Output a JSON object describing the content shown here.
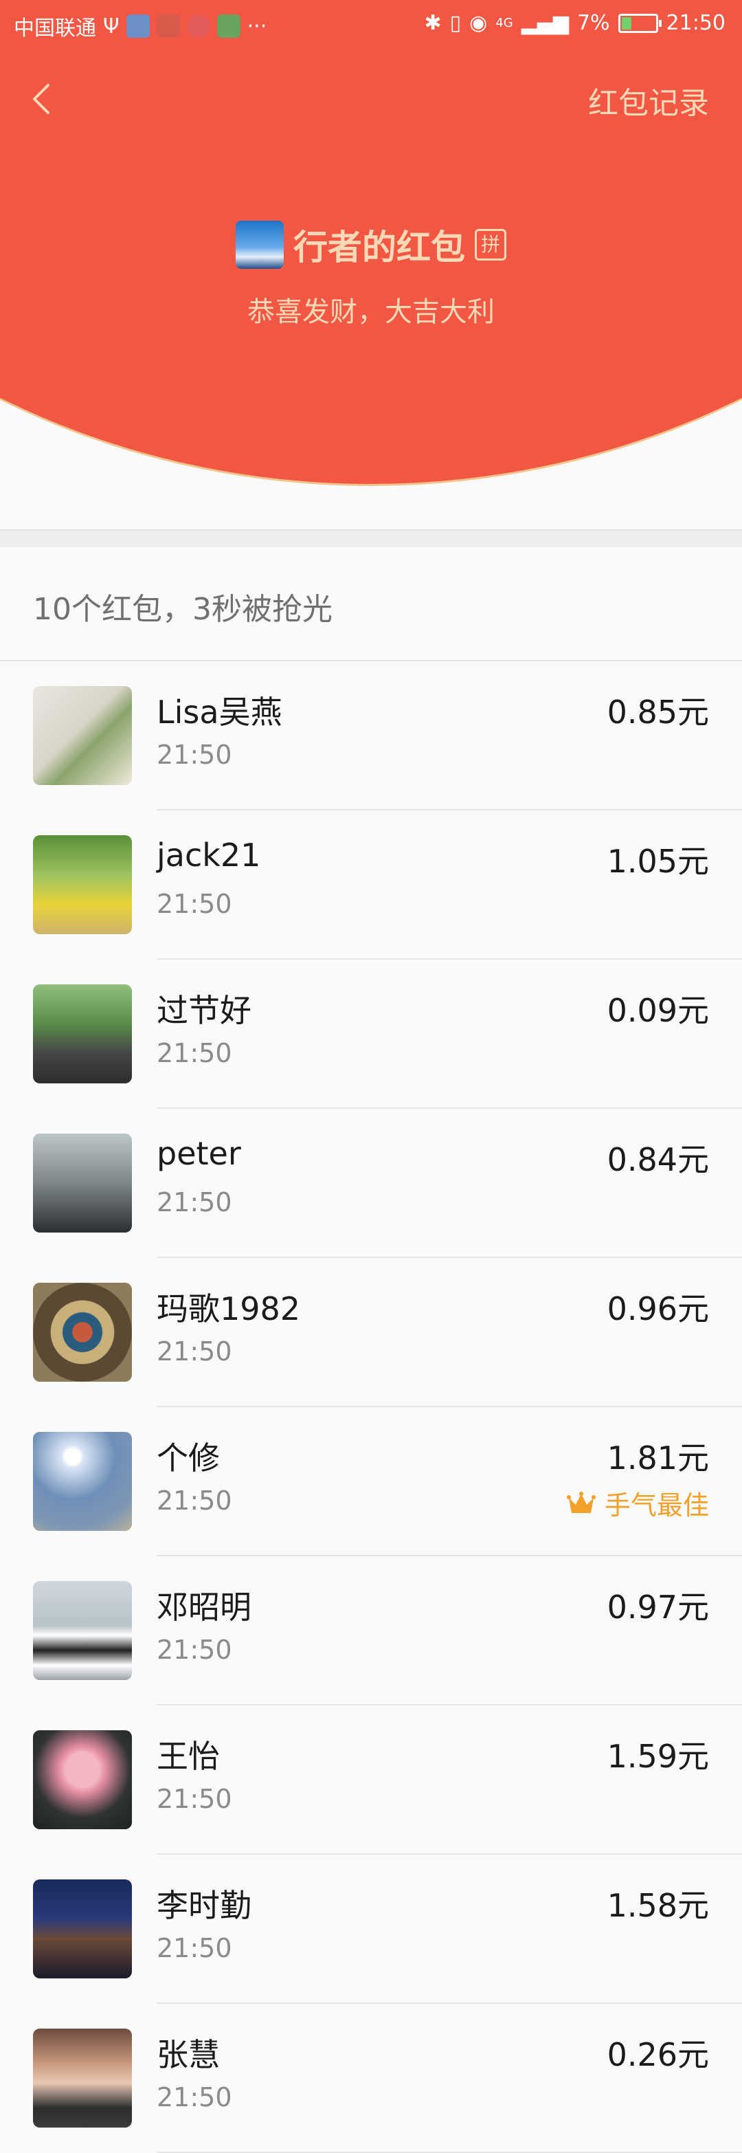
{
  "status_bar": {
    "carrier": "中国联通",
    "extra": "···",
    "network": "4G",
    "battery_percent": "7%",
    "time": "21:50"
  },
  "nav": {
    "back_icon": "chevron-left-icon",
    "record_label": "红包记录"
  },
  "owner": {
    "name": "行者的红包",
    "pin_badge": "拼",
    "greeting": "恭喜发财，大吉大利"
  },
  "summary": "10个红包，3秒被抢光",
  "best_label": "手气最佳",
  "colors": {
    "header_red": "#f25743",
    "header_text": "#fbd9b6",
    "best_gold": "#f2a02a"
  },
  "records": [
    {
      "name": "Lisa吴燕",
      "time": "21:50",
      "amount": "0.85元"
    },
    {
      "name": "jack21",
      "time": "21:50",
      "amount": "1.05元"
    },
    {
      "name": "过节好",
      "time": "21:50",
      "amount": "0.09元"
    },
    {
      "name": "peter",
      "time": "21:50",
      "amount": "0.84元"
    },
    {
      "name": "玛歌1982",
      "time": "21:50",
      "amount": "0.96元"
    },
    {
      "name": "个修",
      "time": "21:50",
      "amount": "1.81元",
      "best": true
    },
    {
      "name": "邓昭明",
      "time": "21:50",
      "amount": "0.97元"
    },
    {
      "name": "王怡",
      "time": "21:50",
      "amount": "1.59元"
    },
    {
      "name": "李时勤",
      "time": "21:50",
      "amount": "1.58元"
    },
    {
      "name": "张慧",
      "time": "21:50",
      "amount": "0.26元"
    }
  ]
}
